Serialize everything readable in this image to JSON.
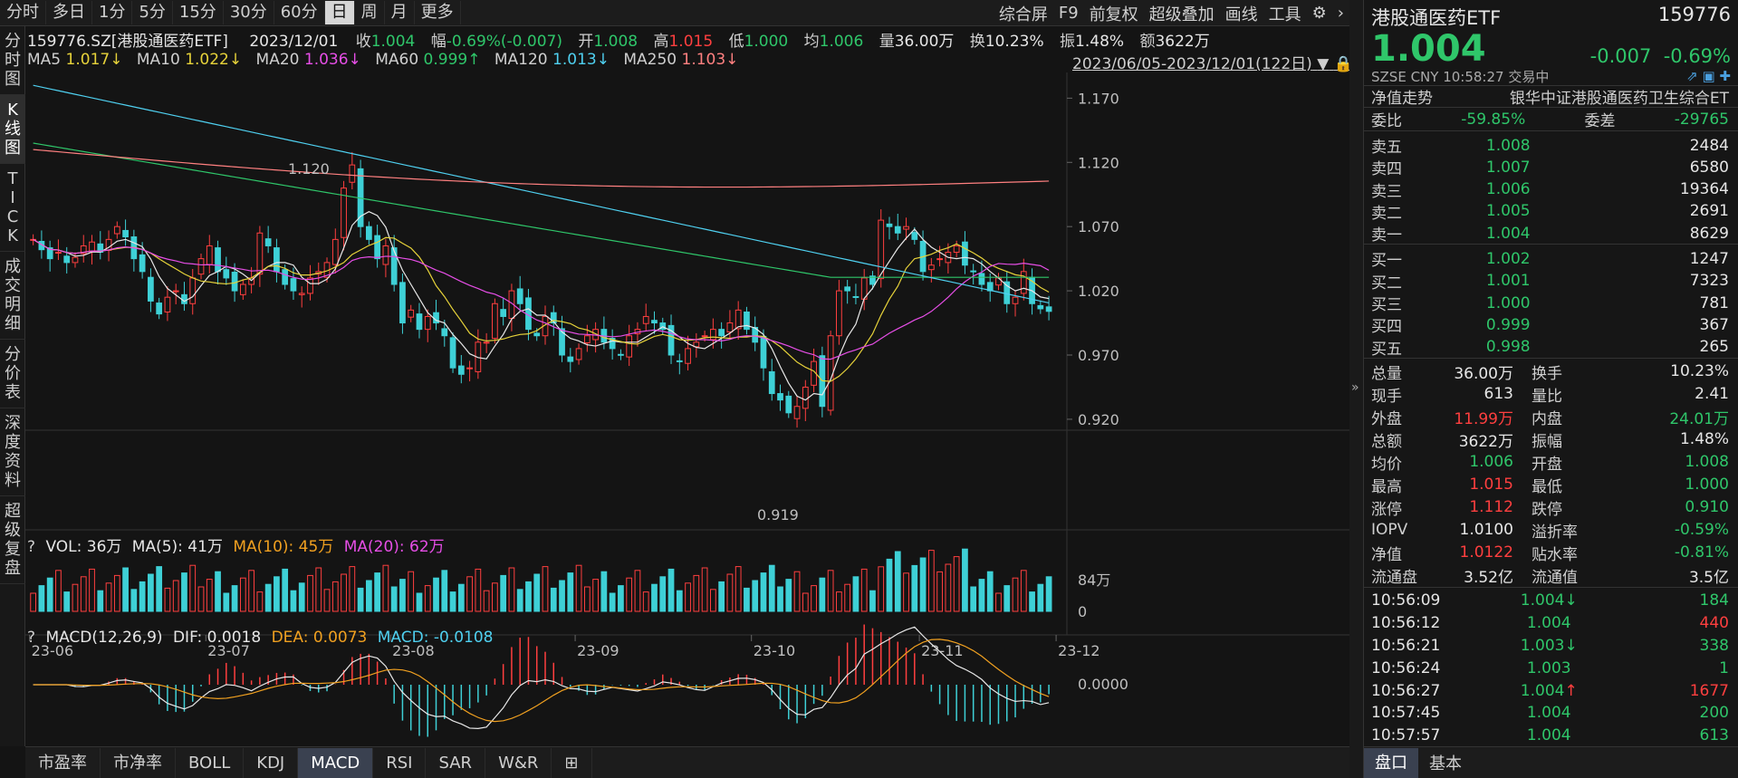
{
  "periods": [
    "分时",
    "多日",
    "1分",
    "5分",
    "15分",
    "30分",
    "60分",
    "日",
    "周",
    "月",
    "更多"
  ],
  "active_period": "日",
  "tools": [
    "综合屏",
    "F9",
    "前复权",
    "超级叠加",
    "画线",
    "工具"
  ],
  "leftnav": [
    "分时图",
    "K线图",
    "TICK",
    "成交明细",
    "分价表",
    "深度资料",
    "超级复盘"
  ],
  "info": {
    "code": "159776.SZ[港股通医药ETF]",
    "date": "2023/12/01",
    "close_label": "收",
    "close": "1.004",
    "chg_label": "幅",
    "chg": "-0.69%(-0.007)",
    "open_label": "开",
    "open": "1.008",
    "high_label": "高",
    "high": "1.015",
    "low_label": "低",
    "low": "1.000",
    "avg_label": "均",
    "avg": "1.006",
    "vol_label": "量",
    "vol": "36.00万",
    "turn_label": "换",
    "turn": "10.23%",
    "amp_label": "振",
    "amp": "1.48%",
    "amt_label": "额",
    "amt": "3622万",
    "ma5": "MA5 ",
    "ma5v": "1.017↓",
    "ma10": "MA10 ",
    "ma10v": "1.022↓",
    "ma20": "MA20 ",
    "ma20v": "1.036↓",
    "ma60": "MA60 ",
    "ma60v": "0.999↑",
    "ma120": "MA120 ",
    "ma120v": "1.013↓",
    "ma250": "MA250 ",
    "ma250v": "1.103↓",
    "range": "2023/06/05-2023/12/01(122日)"
  },
  "vol_info": {
    "q": "?",
    "vol": "VOL: 36万",
    "ma5": "MA(5): 41万",
    "ma10": "MA(10): 45万",
    "ma20": "MA(20): 62万"
  },
  "macd_info": {
    "q": "?",
    "name": "MACD(12,26,9)",
    "dif": "DIF: 0.0018",
    "dea": "DEA: 0.0073",
    "macd": "MACD: -0.0108"
  },
  "bottom_tabs": [
    "市盈率",
    "市净率",
    "BOLL",
    "KDJ",
    "MACD",
    "RSI",
    "SAR",
    "W&R"
  ],
  "active_bottom": "MACD",
  "colors": {
    "up": "#ff3f3f",
    "down": "#3ed0d6",
    "ma5": "#e8e8e8",
    "ma10": "#e6d23a",
    "ma20": "#e64ee6",
    "ma60": "#2fc66a",
    "ma120": "#4fd0f0",
    "ma250": "#ff8080"
  },
  "chart_data": {
    "type": "candlestick",
    "x_ticks": [
      "23-06",
      "23-07",
      "23-08",
      "23-09",
      "23-10",
      "23-11",
      "23-12"
    ],
    "y_ticks": [
      "1.170",
      "1.120",
      "1.070",
      "1.020",
      "0.970",
      "0.920"
    ],
    "ylim": [
      0.915,
      1.19
    ],
    "annotations": [
      {
        "text": "1.120",
        "type": "max"
      },
      {
        "text": "0.919",
        "type": "min"
      }
    ],
    "vol_ticks": [
      "84万",
      "0"
    ],
    "macd_ticks": [
      "0.0000"
    ],
    "closes": [
      1.06,
      1.052,
      1.045,
      1.05,
      1.042,
      1.046,
      1.055,
      1.058,
      1.05,
      1.06,
      1.07,
      1.062,
      1.045,
      1.035,
      1.012,
      1.002,
      1.015,
      1.02,
      1.01,
      1.03,
      1.045,
      1.055,
      1.035,
      1.03,
      1.02,
      1.025,
      1.03,
      1.065,
      1.055,
      1.035,
      1.025,
      1.02,
      1.018,
      1.03,
      1.035,
      1.042,
      1.06,
      1.1,
      1.118,
      1.07,
      1.06,
      1.045,
      1.055,
      1.025,
      0.995,
      1.005,
      0.99,
      1.0,
      0.995,
      0.985,
      0.96,
      0.955,
      0.96,
      0.98,
      0.98,
      1.01,
      1.0,
      1.02,
      1.01,
      0.99,
      0.985,
      1.0,
      0.995,
      0.97,
      0.965,
      0.975,
      0.985,
      0.99,
      0.98,
      0.975,
      0.97,
      0.985,
      0.99,
      1.0,
      0.995,
      0.99,
      0.97,
      0.965,
      0.975,
      0.98,
      0.985,
      0.99,
      0.985,
      0.995,
      1.005,
      0.99,
      0.98,
      0.96,
      0.94,
      0.935,
      0.925,
      0.93,
      0.945,
      0.965,
      0.93,
      0.985,
      1.02,
      1.02,
      1.015,
      1.03,
      1.025,
      1.075,
      1.07,
      1.065,
      1.07,
      1.06,
      1.035,
      1.04,
      1.045,
      1.05,
      1.055,
      1.04,
      1.035,
      1.025,
      1.02,
      1.03,
      1.01,
      1.015,
      1.035,
      1.01,
      1.006,
      1.004
    ]
  }
}
